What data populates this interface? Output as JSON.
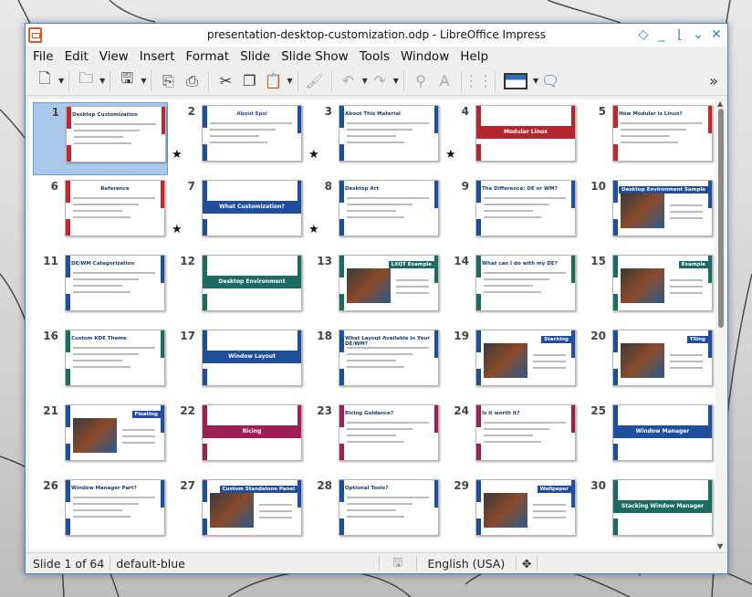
{
  "window": {
    "title": "presentation-desktop-customization.odp - LibreOffice Impress"
  },
  "menu": [
    "File",
    "Edit",
    "View",
    "Insert",
    "Format",
    "Slide",
    "Slide Show",
    "Tools",
    "Window",
    "Help"
  ],
  "slides": [
    {
      "num": "1",
      "title": "Desktop Customization",
      "style": "title",
      "accent": "#c2272d"
    },
    {
      "num": "2",
      "title": "About Epsi",
      "style": "about",
      "accent": "#1f4e9c",
      "star": true
    },
    {
      "num": "3",
      "title": "About This Material",
      "style": "text",
      "accent": "#1f4e9c",
      "star": true
    },
    {
      "num": "4",
      "title": "Modular Linux",
      "style": "banner",
      "accent": "#b3262d",
      "star": true
    },
    {
      "num": "5",
      "title": "How Modular is Linux?",
      "style": "text",
      "accent": "#c2272d"
    },
    {
      "num": "6",
      "title": "Reference",
      "style": "ref",
      "accent": "#c2272d"
    },
    {
      "num": "7",
      "title": "What Customization?",
      "style": "banner",
      "accent": "#1f4e9c",
      "star": true
    },
    {
      "num": "8",
      "title": "Desktop Art",
      "style": "text",
      "accent": "#1f4e9c",
      "star": true
    },
    {
      "num": "9",
      "title": "The Difference: DE or WM?",
      "style": "text",
      "accent": "#1f4e9c"
    },
    {
      "num": "10",
      "title": "Desktop Environment Sample",
      "style": "image",
      "accent": "#1f4e9c"
    },
    {
      "num": "11",
      "title": "DE/WM Categorization",
      "style": "text",
      "accent": "#1f4e9c"
    },
    {
      "num": "12",
      "title": "Desktop Environment Customization",
      "style": "banner",
      "accent": "#1b6b63"
    },
    {
      "num": "13",
      "title": "LXQT Example",
      "style": "image",
      "accent": "#1b6b63"
    },
    {
      "num": "14",
      "title": "What can I do with my DE?",
      "style": "text",
      "accent": "#1b6b63"
    },
    {
      "num": "15",
      "title": "Example",
      "style": "image",
      "accent": "#1b6b63"
    },
    {
      "num": "16",
      "title": "Custom KDE Theme",
      "style": "text",
      "accent": "#1b6b63"
    },
    {
      "num": "17",
      "title": "Window Layout",
      "style": "banner",
      "accent": "#1f4e9c"
    },
    {
      "num": "18",
      "title": "What Layout Available in Your DE/WM?",
      "style": "text",
      "accent": "#1f4e9c"
    },
    {
      "num": "19",
      "title": "Stacking",
      "style": "image",
      "accent": "#1f4e9c"
    },
    {
      "num": "20",
      "title": "Tiling",
      "style": "image",
      "accent": "#1f4e9c"
    },
    {
      "num": "21",
      "title": "Floating",
      "style": "image",
      "accent": "#1f4e9c"
    },
    {
      "num": "22",
      "title": "Ricing",
      "style": "banner",
      "accent": "#9c1f55"
    },
    {
      "num": "23",
      "title": "Ricing Guidance?",
      "style": "text",
      "accent": "#9c1f55"
    },
    {
      "num": "24",
      "title": "Is it worth it?",
      "style": "text",
      "accent": "#9c1f55"
    },
    {
      "num": "25",
      "title": "Window Manager Customization",
      "style": "banner",
      "accent": "#1f4e9c"
    },
    {
      "num": "26",
      "title": "Window Manager Part?",
      "style": "text",
      "accent": "#1f4e9c"
    },
    {
      "num": "27",
      "title": "Custom Standalone Panel",
      "style": "image",
      "accent": "#1f4e9c"
    },
    {
      "num": "28",
      "title": "Optional Tools?",
      "style": "text",
      "accent": "#1f4e9c"
    },
    {
      "num": "29",
      "title": "Wallpaper",
      "style": "image",
      "accent": "#1f4e9c"
    },
    {
      "num": "30",
      "title": "Stacking Window Manager",
      "style": "banner",
      "accent": "#1b6b63"
    }
  ],
  "status": {
    "slide": "Slide 1 of 64",
    "master": "default-blue",
    "language": "English (USA)"
  }
}
